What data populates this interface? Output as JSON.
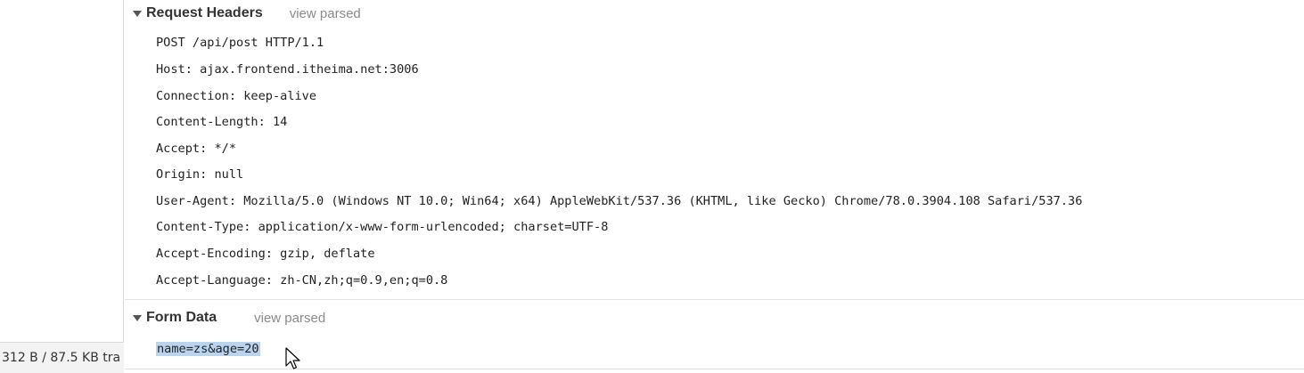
{
  "status_bar": {
    "text": "312 B / 87.5 KB tra"
  },
  "request_headers": {
    "title": "Request Headers",
    "view_label": "view parsed",
    "lines": [
      "POST /api/post HTTP/1.1",
      "Host: ajax.frontend.itheima.net:3006",
      "Connection: keep-alive",
      "Content-Length: 14",
      "Accept: */*",
      "Origin: null",
      "User-Agent: Mozilla/5.0 (Windows NT 10.0; Win64; x64) AppleWebKit/537.36 (KHTML, like Gecko) Chrome/78.0.3904.108 Safari/537.36",
      "Content-Type: application/x-www-form-urlencoded; charset=UTF-8",
      "Accept-Encoding: gzip, deflate",
      "Accept-Language: zh-CN,zh;q=0.9,en;q=0.8"
    ]
  },
  "form_data": {
    "title": "Form Data",
    "view_label": "view parsed",
    "raw": "name=zs&age=20"
  },
  "icons": {
    "expand": "triangle-down-icon",
    "cursor": "mouse-pointer-icon"
  },
  "colors": {
    "selection": "#b9d4ee",
    "muted_text": "#8a8a8a"
  }
}
